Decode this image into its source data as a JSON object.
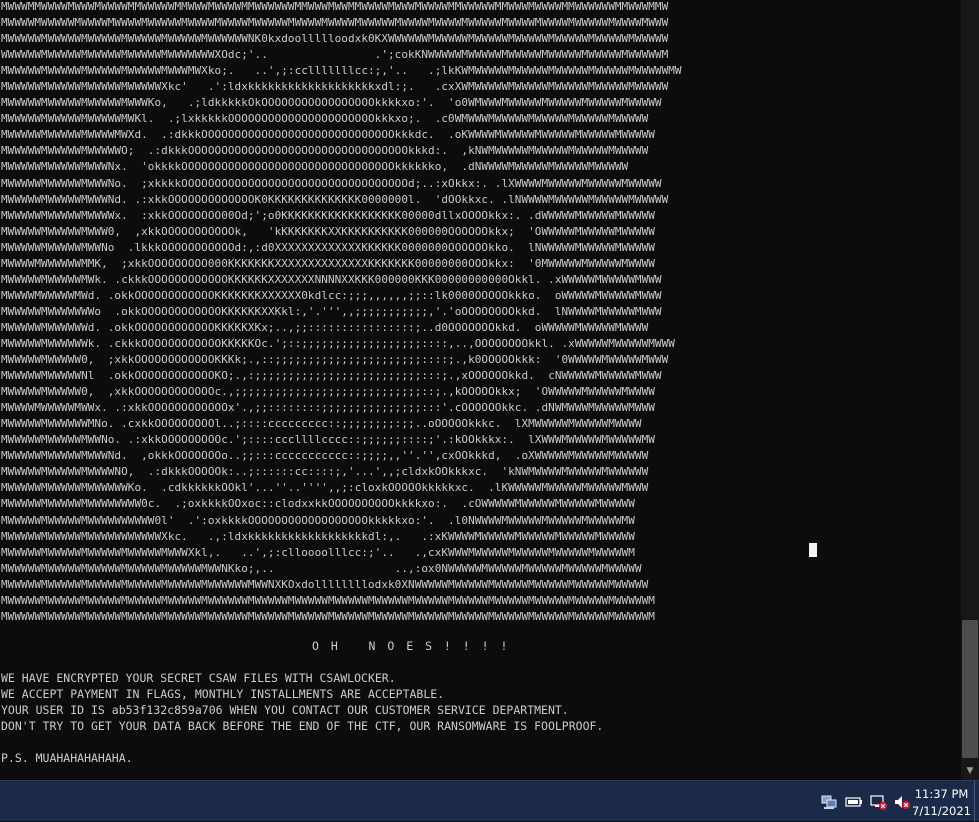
{
  "window": {
    "art_lines": [
      "MWWWMMWWWWMWWWMWWWWMMWWWWWMMWWWMWWWWMMWWWWWWMMWWWMWWMMWWWWMWWWMWWWWMMWWWWWMMWWWMWWWWMMWWWWWWMMWWWMMW",
      "MWWWWMWWWWWMWWWWMWWWWMWWWWWMWWWWMWWWWMWWWWWMWWWWMWWWWMWWWWWMWWWWMWWWWMWWWWWMWWWWMWWWWMWWWWWMWWWWMWWW",
      "MWWWWWMWWWWWMWWWWWMWWWWWMWWWWWMWWWWWWNK0kxdoollllloodxk0KXWWWWWWMWWWWWMWWWWWMWWWWWMWWWWWMWWWWWMWWWWW",
      "WWWWWWMWWWWWMWWWWWMWWWWWMWWWWWWWXOdc;'..                .';cokKNWWWWWMWWWWWMWWWWWMWWWWWMWWWWWMWWWWWM",
      "MWWWWWMWWWWWMWWWWWMWWWWWMWWWMWXko;.   ..',;:cclllllllcc:;,'..   .;lkKWMWWWWWMWWWWWMWWWWWMWWWWWMWWWWWMW",
      "MWWWWWMWWWWWMWWWWWMWWWWWXkc'   .':ldxkkkkkkkkkkkkkkkkkkkxdl:;.   .cxXWMWWWWWMWWWWWMWWWWWMWWWWWMWWWWW",
      "MWWWWWMWWWWWMWWWWWMWWWKo,   .;ldkkkkkOkOOOOOOOOOOOOOOOOOkkkkxo:'.  'o0WMWWWMWWWWWMWWWWWMWWWWWMWWWWW",
      "MWWWWWMWWWWWMWWWWWMWKl.  .;lxkkkkkOOOOOOOOOOOOOOOOOOOOOOkkkxo;.  .c0WMWWWMWWWWWMWWWWWMWWWWWMWWWWW",
      "MWWWWWMWWWWWMWWWWMWXd.  .:dkkkOOOOOOOOOOOOOOOOOOOOOOOOOOOOOkkkdc.  .oKWWWWMWWWWWMWWWWWMWWWWWMWWWWW",
      "MWWWWWMWWWWWMWWWWWO;  .:dkkkOOOOOOOOOOOOOOOOOOOOOOOOOOOOOOOOOkkkd:.  ,kNWMWWWWWMWWWWWMWWWWWMWWWWW",
      "MWWWWWMWWWWWMWWWNx.  'okkkkOOOOOOOOOOOOOOOOOOOOOOOOOOOOOOOOkkkkkko,  .dNWWWWMWWWWWMWWWWWMWWWWW",
      "MWWWWWMWWWWWMWWWNo.  ;xkkkkOOOOOOOOOOOOOOOOOOOOOOOOOOOOOOOOOOd;..:xOkkx:. .lXWWWWMWWWWWMWWWWWMWWWWW",
      "MWWWWWMWWWWWMWWWNd. .:xkkOOOOOOOOOOOOOK0KKKKKKKKKKKKKK0000000l.  'dOOkkxc. .lNWWWWMWWWWWMWWWWWMWWWWW",
      "MWWWWWMWWWWWMWWWWx.  :xkkOOOOOOOO00Od;';o0KKKKKKKKKKKKKKKKKK00000dllxOOOOkkx:. .dWWWWWMWWWWWMWWWWW",
      "MWWWWWMWWWWWMWWW0,  ,xkkOOOOOOOOOOOk,   'kKKKKKKKXXKKKKKKKKKK000000OOOOOOkkx;  'OWWWWWMWWWWWMWWWWW",
      "MWWWWWMWWWWWMWWNo  .lkkkOOOOOOOOOOOd:,:d0XXXXXXXXXXXXXKKKKKK0000000OOOOOOkko.  lNWWWWWMWWWWWMWWWWW",
      "MWWWWMWWWWWWMMK,  ;xkkOOOOOOOOO000KKKKKKKXXXXXXXXXXXXXXKKKKKKK00000000OOOkkx:  '0MWWWWWMWWWWWMWWWW",
      "MWWWWWMWWWWWMWk. .ckkkOOOOOOOOOOOOKKKKKKXXXXXXXNNNNXXKKK000000KKK00000000000Okkl. .xWWWWWMWWWWWMWWW",
      "MWWWWMWWWWWMWd. .okkOOOOOOOOOOOOKKKKKKKXXXXXX0kdlcc:;;;,,,,,,;;::lk0000OOOOOkkko.  oWWWWWMWWWWWMWWW",
      "MWWWWWMWWWWWWWo  .okkOOOOOOOOOOOOKKKKKKXXKkl:,'.''',,;;;;;;;;;;;,'.'oOOOOOOOOkkd.  lNWWWWMWWWWWMWWW",
      "MWWWWWMWWWWWWd. .okkOOOOOOOOOOOOKKKKKXKx;..,;;::::::::::::::::;..d0OOOOOOOkkd.  oWWWWWMWWWWWMWWWW",
      "MWWWWWMWWWWWWk. .ckkkOOOOOOOOOOOOKKKKKOc.';::;;;;;;;;;;;;;;;;;;::::,..,OOOOOOOOkkl. .xWWWWWMWWWWWMWWW",
      "MWWWWWMWWWWW0,  ;xkkOOOOOOOOOOOOKKKk;.,::;;;;;;;;;;;;;;;;;;;;;;::::;.,k0OOOOOkkk:  '0WWWWWMWWWWWMWWW",
      "MWWWWWMWWWWWNl  .okkOOOOOOOOOOOOKO;.,:;;;;;;;;;;;;;;;;;;;;;;;;;:::;.,xOOOOOOkkd.  cNWWWWWMWWWWWMWWW",
      "MWWWWWMWWWWW0,  ,xkkOOOOOOOOOOOOc.,;;;;;;;;;;;;;;;;;;;;;;;;;;;;::;.,kOOOOOkkx;  'OWWWWWMWWWWWMWWWW",
      "MWWWWMWWWWWMWWx. .:xkkOOOOOOOOOOOOx'.,;;::::::::;;;;;;;;;;;;;;;:::'.cOOOOOOkkc. .dNWMWWWMWWWWWMWWW",
      "MWWWWWMWWWWWWMNo. .cxkkOOOOOOOOOl..;::::ccccccccc::;;;;;;;;:;;..oOOOOOkkkc.  lXMWWWWWMWWWWWMWWWW",
      "MWWWWWMWWWWWMWWNo. .:xkkOOOOOOOOOc.';::::cccllllcccc::;;;;;;::::;'.:kOOkkkx:.  lXWWWMWWWWWMWWWWWMW",
      "MWWWWWMWWWWWMWWWNd.  ,okkkOOOOOOOo..;;:::ccccccccccc::;;;;,,''.'',cxOOkkkd,  .oXWWWWWMWWWWWMWWWWW",
      "MWWWWWMWWWWWMWWWWNO,  .:dkkkOOOOOk:..;::::::cc::::;,'...',,;cldxkOOkkkxc.  'kNWMWWWWMWWWWWMWWWWWW",
      "MWWWWWMWWWWWMWWWWWWKo.  .cdkkkkkkOOkl'...''..'''',,;:cloxkOOOOOkkkkkxc.  .lKWWWWWMWWWWWMWWWWWMWWW",
      "MWWWWWMWWWWWMWWWWWWWW0c.  .;oxkkkkOOxoc::clodxxkkOOOOOOOOOOkkkkxo:.  .cOWWWWWMWWWWWMWWWWWMWWWWW",
      "MWWWWWMWWWWWMWWWWWWWWWW0l'  .':oxkkkkOOOOOOOOOOOOOOOOOOkkkkkxo:'.  .l0NWWWWMWWWWWMWWWWWMWWWWWMW",
      "MWWWWWMWWWWWMWWWWWWWWWWWXkc.   .,:ldxkkkkkkkkkkkkkkkkkkdl:,.   .:xKWWWWMWWWWWMWWWWWMWWWWWMWWWWW",
      "MWWWWWMWWWWWMWWWWWMWWWWWMWWWXkl,.   ..',;:clloooolllcc:;'..   .,cxKWWWMWWWWWMWWWWWMWWWWWMWWWWWM",
      "MWWWWWMWWWWWMWWWWWMWWWWWMWWWWWMWWNKko;,..                  ..,:ox0NWWWWWMWWWWWMWWWWWMWWWWWMWWWWW",
      "MWWWWWMWWWWWMWWWWWMWWWWWMWWWWWMWWWWWWMWWNXKOxdollllllllodxk0XNWWWWWMWWWWWMWWWWWMWWWWWMWWWWWMWWWWW",
      "MWWWWWMWWWWWMWWWWWMWWWWWMWWWWWMWWWWWWMWWWWWMWWWWWMWWWWWMWWWWWMWWWWWMWWWWWMWWWWWMWWWWWMWWWWWMWWWWWM",
      "MWWWWWMWWWWWMWWWWWMWWWWWMWWWWWMWWWWWWMWWWWWMWWWWWMWWWWWMWWWWWMWWWWWMWWWWWMWWWWWMWWWWWMWWWWWMWWWWWM"
    ],
    "headline": "O H   N O E S ! ! ! !",
    "body_lines": [
      "WE HAVE ENCRYPTED YOUR SECRET CSAW FILES WITH CSAWLOCKER.",
      "WE ACCEPT PAYMENT IN FLAGS, MONTHLY INSTALLMENTS ARE ACCEPTABLE.",
      "YOUR USER ID IS ab53f132c859a706 WHEN YOU CONTACT OUR CUSTOMER SERVICE DEPARTMENT.",
      "DON'T TRY TO GET YOUR DATA BACK BEFORE THE END OF THE CTF, OUR RANSOMWARE IS FOOLPROOF."
    ],
    "ps": "P.S. MUAHAHAHAHAHA."
  },
  "scrollbar": {
    "down_arrow": "▼"
  },
  "taskbar": {
    "tray_icons": [
      "network-tower-icon",
      "battery-icon",
      "network-error-icon",
      "volume-muted-icon"
    ],
    "time": "11:37 PM",
    "date": "7/11/2021"
  },
  "colors": {
    "console_bg": "#0c0c0c",
    "console_text": "#cccccc",
    "taskbar_bg": "#1c2a4a"
  }
}
